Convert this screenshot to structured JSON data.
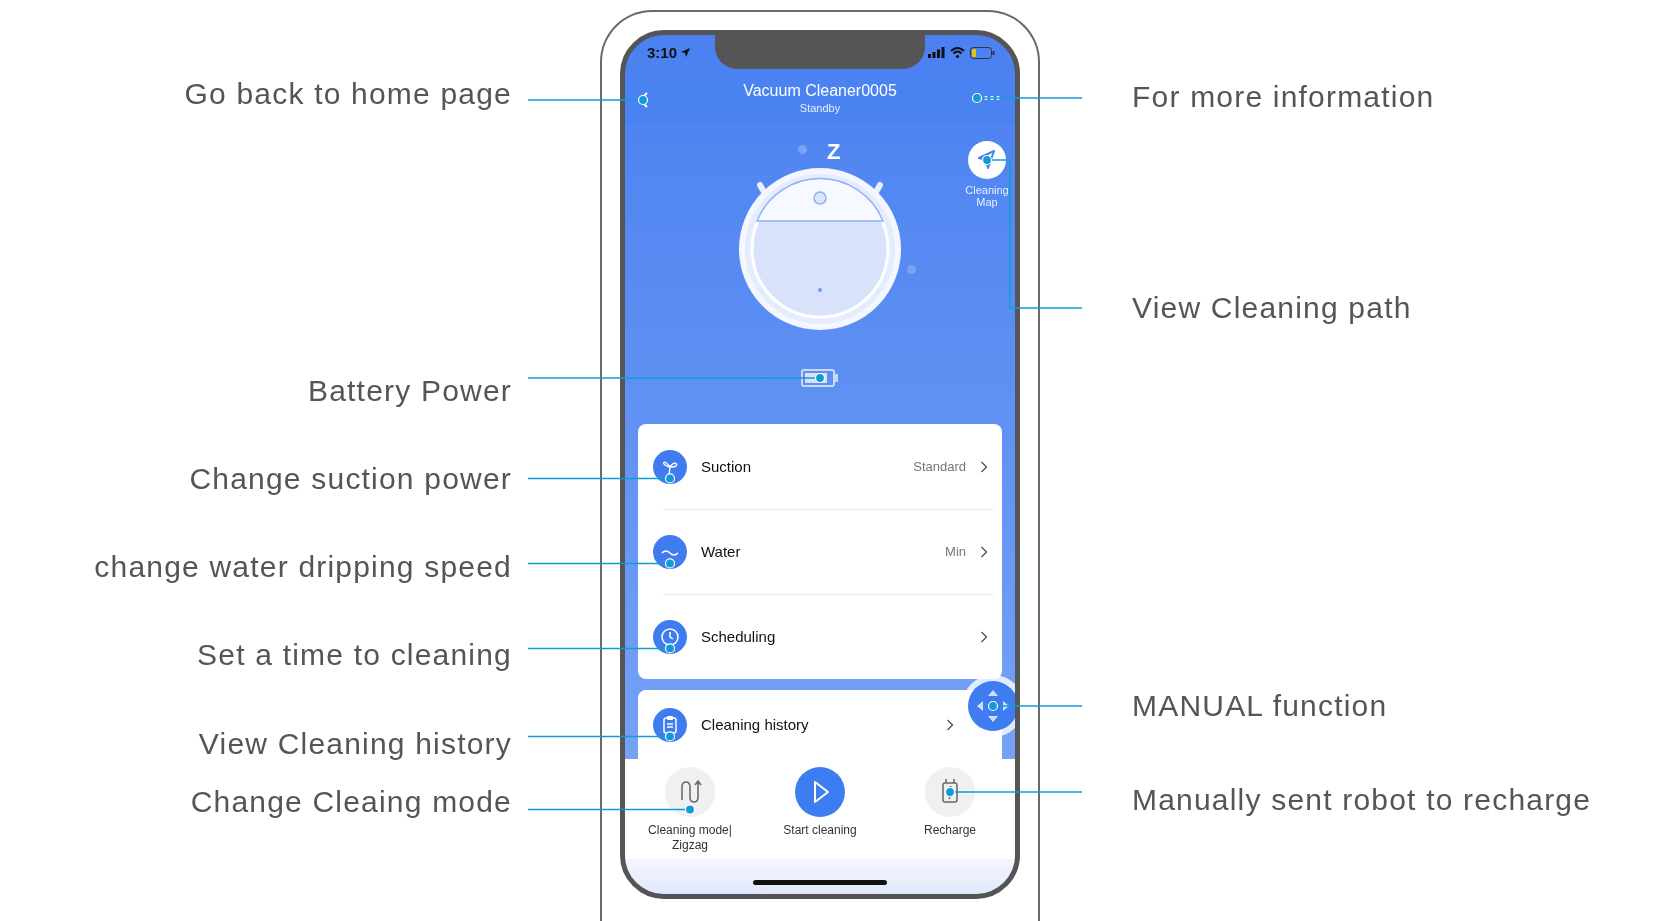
{
  "status_bar": {
    "time": "3:10"
  },
  "header": {
    "title": "Vacuum Cleaner0005",
    "subtitle": "Standby"
  },
  "robot": {
    "sleep_mark": "Z"
  },
  "map_button": {
    "label": "Cleaning Map"
  },
  "settings": [
    {
      "kind": "fan",
      "label": "Suction",
      "value": "Standard"
    },
    {
      "kind": "water",
      "label": "Water",
      "value": "Min"
    },
    {
      "kind": "clock",
      "label": "Scheduling"
    }
  ],
  "history": {
    "label": "Cleaning history"
  },
  "actions": [
    {
      "kind": "mode",
      "lines": [
        "Cleaning mode|",
        "Zigzag"
      ]
    },
    {
      "kind": "start",
      "lines": [
        "Start cleaning"
      ]
    },
    {
      "kind": "recharge",
      "lines": [
        "Recharge"
      ]
    }
  ],
  "annotations": [
    {
      "kind": "left",
      "text": "Go back to home page"
    },
    {
      "kind": "left",
      "text": "Battery Power"
    },
    {
      "kind": "left",
      "text": "Change suction power"
    },
    {
      "kind": "left",
      "text": "change water dripping speed"
    },
    {
      "kind": "left",
      "text": "Set a time to cleaning"
    },
    {
      "kind": "left",
      "text": "View Cleaning history"
    },
    {
      "kind": "left",
      "text": "Change Cleaing mode"
    },
    {
      "kind": "right",
      "text": "For more information"
    },
    {
      "kind": "right",
      "text": "View Cleaning path"
    },
    {
      "kind": "right",
      "text": "MANUAL function"
    },
    {
      "kind": "right",
      "text": "Manually sent robot to recharge"
    }
  ]
}
